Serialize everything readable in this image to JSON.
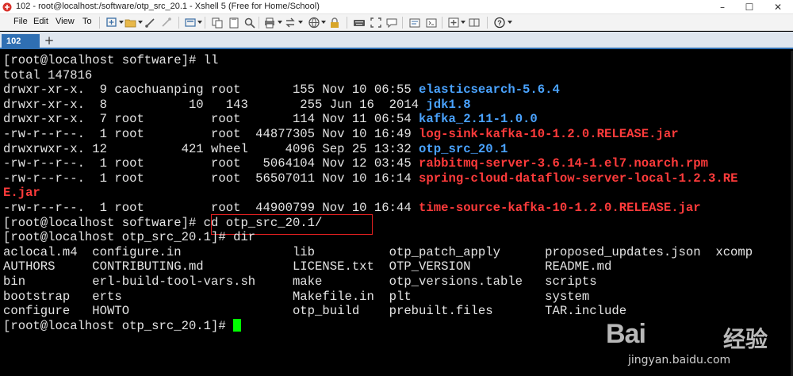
{
  "window": {
    "title": "102 - root@localhost:/software/otp_src_20.1 - Xshell 5 (Free for Home/School)",
    "minimize": "–",
    "maximize": "☐",
    "close": "✕"
  },
  "menu": [
    "File",
    "Edit",
    "View",
    "To"
  ],
  "toolbar_icons": [
    "new-session-icon",
    "open-folder-icon",
    "reconnect-icon",
    "disconnect-icon",
    "properties-icon",
    "copy-icon",
    "paste-icon",
    "find-icon",
    "print-icon",
    "transfer-icon",
    "globe-icon",
    "lock-icon",
    "keyboard-icon",
    "fullscreen-icon",
    "chat-icon",
    "compose-icon",
    "script-icon",
    "layout-icon",
    "add-icon",
    "help-icon"
  ],
  "tabs": {
    "active": "102",
    "add": "+"
  },
  "terminal": {
    "lines": [
      [
        {
          "t": "[root@localhost software]# ll"
        }
      ],
      [
        {
          "t": "total 147816"
        }
      ],
      [
        {
          "t": "drwxr-xr-x.  9 caochuanping root       155 Nov 10 06:55 "
        },
        {
          "t": "elasticsearch-5.6.4",
          "c": "blue"
        }
      ],
      [
        {
          "t": "drwxr-xr-x.  8           10   143       255 Jun 16  2014 "
        },
        {
          "t": "jdk1.8",
          "c": "blue"
        }
      ],
      [
        {
          "t": "drwxr-xr-x.  7 root         root       114 Nov 11 06:54 "
        },
        {
          "t": "kafka_2.11-1.0.0",
          "c": "blue"
        }
      ],
      [
        {
          "t": "-rw-r--r--.  1 root         root  44877305 Nov 10 16:49 "
        },
        {
          "t": "log-sink-kafka-10-1.2.0.RELEASE.jar",
          "c": "red"
        }
      ],
      [
        {
          "t": "drwxrwxr-x. 12          421 wheel     4096 Sep 25 13:32 "
        },
        {
          "t": "otp_src_20.1",
          "c": "blue"
        }
      ],
      [
        {
          "t": "-rw-r--r--.  1 root         root   5064104 Nov 12 03:45 "
        },
        {
          "t": "rabbitmq-server-3.6.14-1.el7.noarch.rpm",
          "c": "red"
        }
      ],
      [
        {
          "t": "-rw-r--r--.  1 root         root  56507011 Nov 10 16:14 "
        },
        {
          "t": "spring-cloud-dataflow-server-local-1.2.3.RE",
          "c": "red"
        }
      ],
      [
        {
          "t": "E.jar",
          "c": "red"
        }
      ],
      [
        {
          "t": "-rw-r--r--.  1 root         root  44900799 Nov 10 16:44 "
        },
        {
          "t": "time-source-kafka-10-1.2.0.RELEASE.jar",
          "c": "red"
        }
      ],
      [
        {
          "t": "[root@localhost software]# cd otp_src_20.1/"
        }
      ],
      [
        {
          "t": "[root@localhost otp_src_20.1]# dir"
        }
      ],
      [
        {
          "t": "aclocal.m4  configure.in               lib          otp_patch_apply      proposed_updates.json  xcomp"
        }
      ],
      [
        {
          "t": "AUTHORS     CONTRIBUTING.md            LICENSE.txt  OTP_VERSION          README.md"
        }
      ],
      [
        {
          "t": "bin         erl-build-tool-vars.sh     make         otp_versions.table   scripts"
        }
      ],
      [
        {
          "t": "bootstrap   erts                       Makefile.in  plt                  system"
        }
      ],
      [
        {
          "t": "configure   HOWTO                      otp_build    prebuilt.files       TAR.include"
        }
      ],
      [
        {
          "t": "[root@localhost otp_src_20.1]# "
        },
        {
          "cursor": true
        }
      ]
    ]
  },
  "colors": {
    "terminal_bg": "#000000",
    "terminal_fg": "#e4e4e4",
    "dir_blue": "#4aa3ff",
    "file_red": "#ff3b3b",
    "cursor_green": "#00ff00",
    "highlight_box": "#e02020",
    "tab_active": "#2f6fb3"
  },
  "watermark": {
    "brand": "Bai",
    "brand_suffix": "经验",
    "url": "jingyan.baidu.com"
  }
}
